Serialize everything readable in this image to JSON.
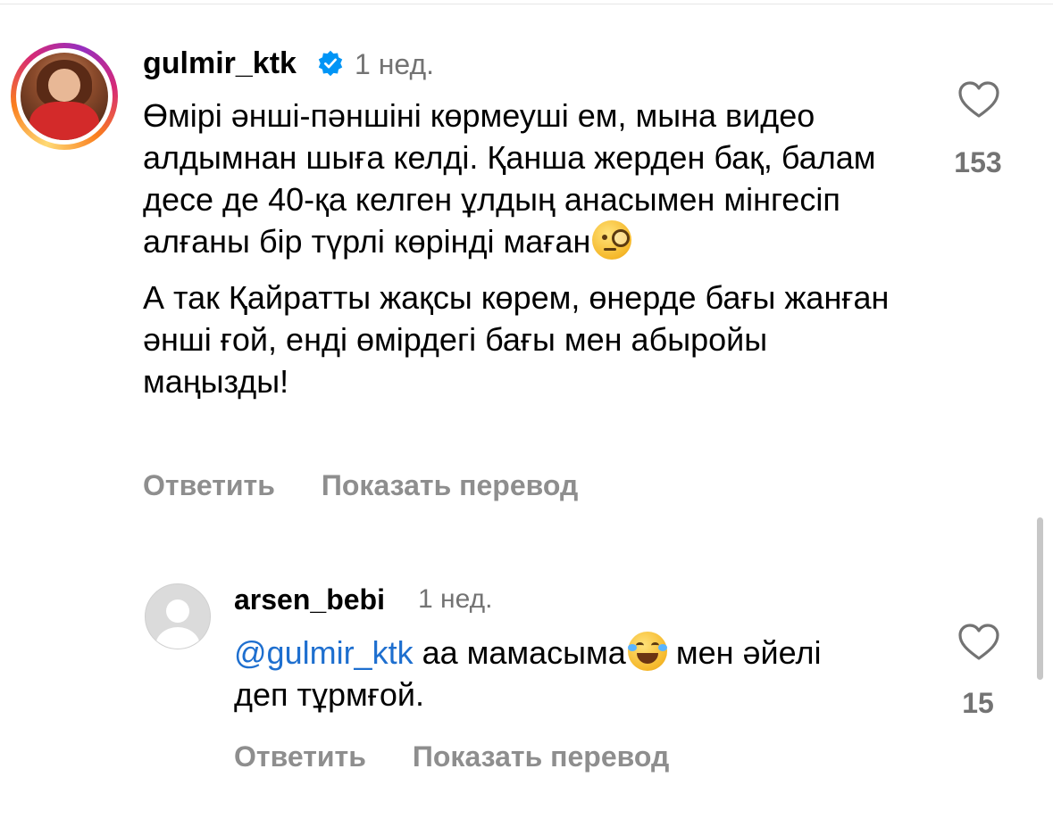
{
  "comments": [
    {
      "username": "gulmir_ktk",
      "verified": true,
      "time": "1 нед.",
      "paragraphs": [
        "Өмірі әнші-пәншіні көрмеуші ем, мына видео алдымнан шыға келді. Қанша жерден бақ, балам десе де 40-қа келген ұлдың анасымен мінгесіп алғаны бір түрлі көрінді маған",
        "А так Қайратты жақсы көрем, өнерде бағы жанған әнші ғой, енді өмірдегі бағы мен абыройы маңызды!"
      ],
      "emoji_icon": "face-with-monocle-icon",
      "likes": "153",
      "reply_label": "Ответить",
      "translate_label": "Показать перевод"
    },
    {
      "username": "arsen_bebi",
      "verified": false,
      "time": "1 нед.",
      "mention": "@gulmir_ktk",
      "text_before_emoji": " аа мамасыма",
      "emoji_icon": "laughing-tears-icon",
      "text_after_emoji": " мен әйелі деп тұрмғой.",
      "likes": "15",
      "reply_label": "Ответить",
      "translate_label": "Показать перевод"
    }
  ],
  "colors": {
    "username": "#000000",
    "meta": "#737373",
    "action": "#8e8e8e",
    "mention": "#1e6fcf",
    "verified": "#0095f6"
  }
}
